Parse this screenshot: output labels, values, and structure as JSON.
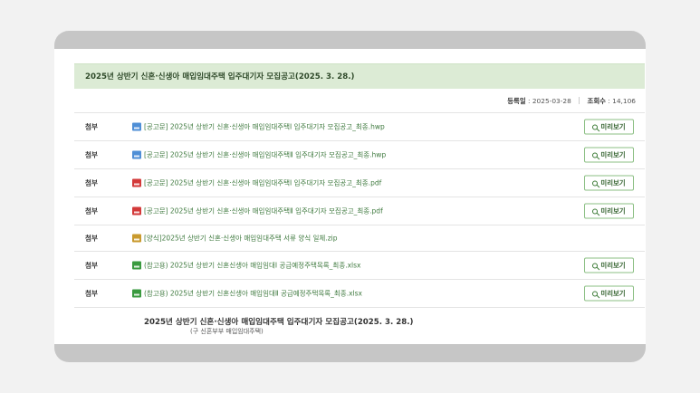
{
  "notice": {
    "title": "2025년 상반기 신혼·신생아 매입임대주택 입주대기자 모집공고(2025. 3. 28.)",
    "reg_label": "등록일",
    "reg_value": "2025-03-28",
    "views_label": "조회수",
    "views_value": "14,106"
  },
  "attachments": [
    {
      "label": "첨부",
      "icon": "hwp-file-icon",
      "name": "[공고문] 2025년 상반기 신혼·신생아 매입임대주택Ⅰ 입주대기자 모집공고_최종.hwp",
      "preview": "미리보기"
    },
    {
      "label": "첨부",
      "icon": "hwp-file-icon",
      "name": "[공고문] 2025년 상반기 신혼·신생아 매입임대주택Ⅱ 입주대기자 모집공고_최종.hwp",
      "preview": "미리보기"
    },
    {
      "label": "첨부",
      "icon": "pdf-file-icon",
      "name": "[공고문] 2025년 상반기 신혼·신생아 매입임대주택Ⅰ 입주대기자 모집공고_최종.pdf",
      "preview": "미리보기"
    },
    {
      "label": "첨부",
      "icon": "pdf-file-icon",
      "name": "[공고문] 2025년 상반기 신혼·신생아 매입임대주택Ⅱ 입주대기자 모집공고_최종.pdf",
      "preview": "미리보기"
    },
    {
      "label": "첨부",
      "icon": "zip-file-icon",
      "name": "[양식]2025년 상반기 신혼·신생아 매입임대주택 서류 양식 일체.zip",
      "preview": ""
    },
    {
      "label": "첨부",
      "icon": "xlsx-file-icon",
      "name": "(참고용) 2025년 상반기 신혼신생아 매입임대Ⅰ 공급예정주택목록_최종.xlsx",
      "preview": "미리보기"
    },
    {
      "label": "첨부",
      "icon": "xlsx-file-icon",
      "name": "(참고용) 2025년 상반기 신혼신생아 매입임대Ⅱ 공급예정주택목록_최종.xlsx",
      "preview": "미리보기"
    }
  ],
  "body": {
    "title": "2025년 상반기 신혼·신생아 매입임대주택 입주대기자 모집공고(2025. 3. 28.)",
    "subtitle": "(구 신혼부부 매입임대주택)"
  },
  "colors": {
    "accent_green": "#dcebd5",
    "link_green": "#3f7a3f",
    "button_border": "#8bbf83"
  }
}
